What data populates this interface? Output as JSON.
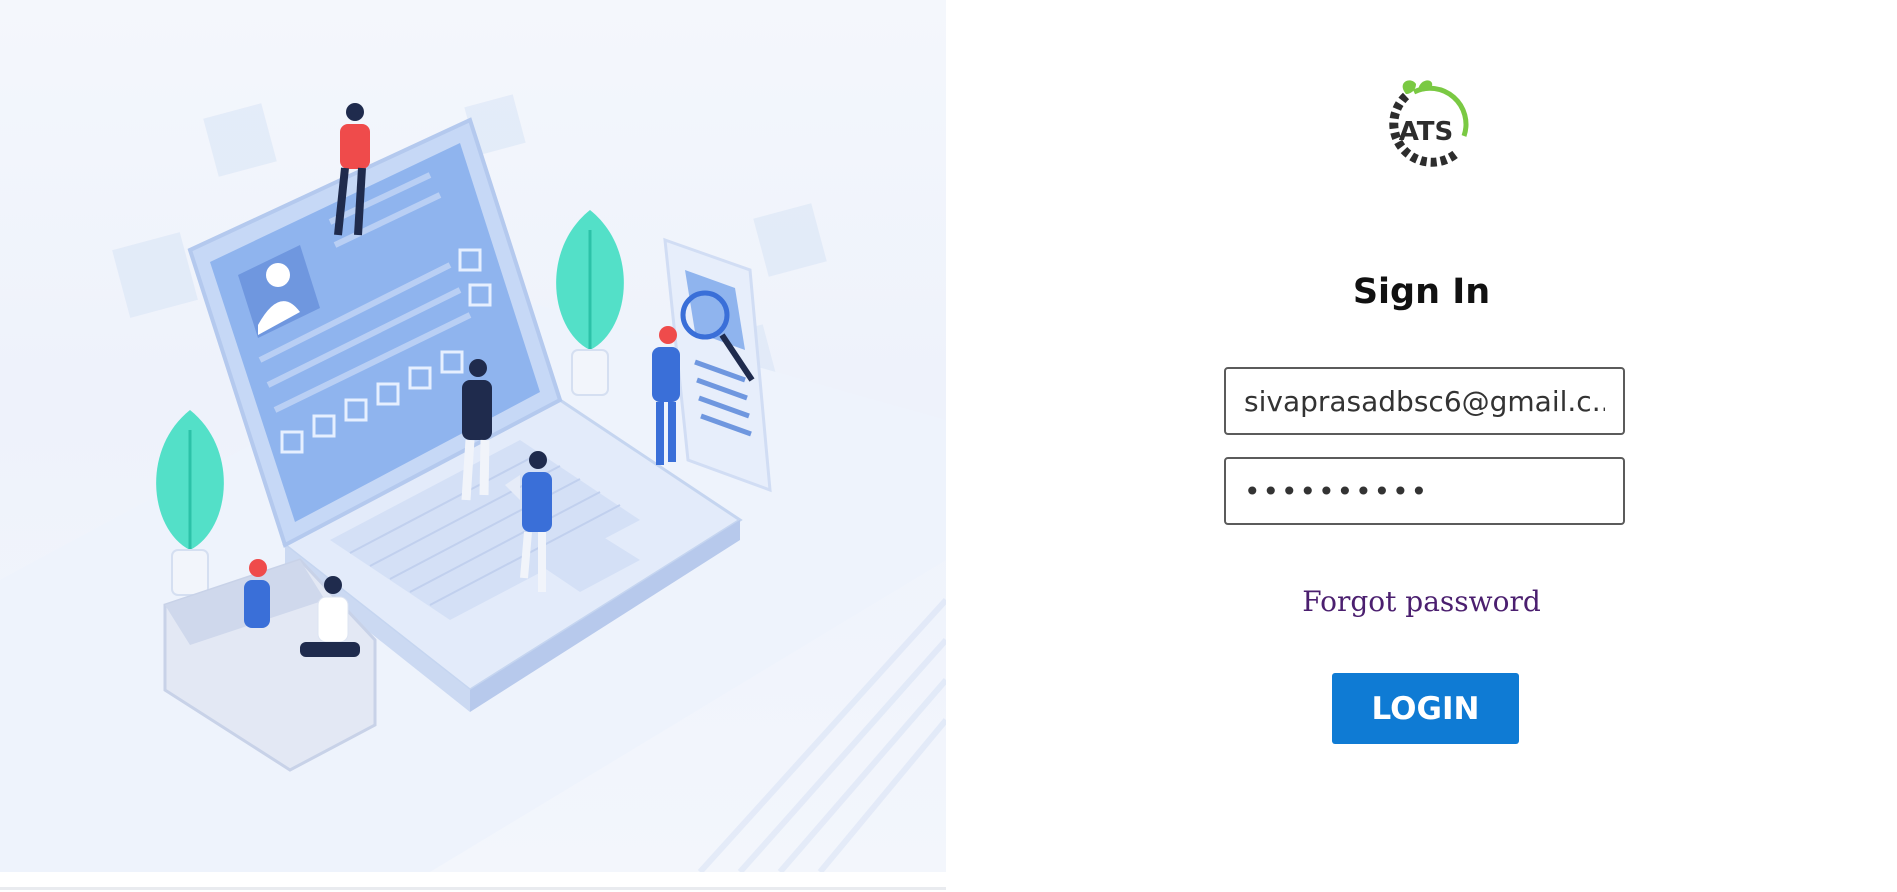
{
  "brand": {
    "logo_text": "ATS",
    "logo_colors": {
      "gear": "#2d2d2d",
      "leaf": "#7ac943",
      "arc": "#7ac943"
    }
  },
  "form": {
    "title": "Sign In",
    "email_value": "sivaprasadbsc6@gmail.c...",
    "password_value": "••••••••••",
    "forgot_label": "Forgot password",
    "login_label": "LOGIN"
  },
  "illustration": {
    "icon": "recruitment-illustration"
  },
  "colors": {
    "accent": "#0f7bd4",
    "link": "#4b1f6f",
    "illustration_blue": "#8fb4ee",
    "plant": "#53e0c8"
  }
}
